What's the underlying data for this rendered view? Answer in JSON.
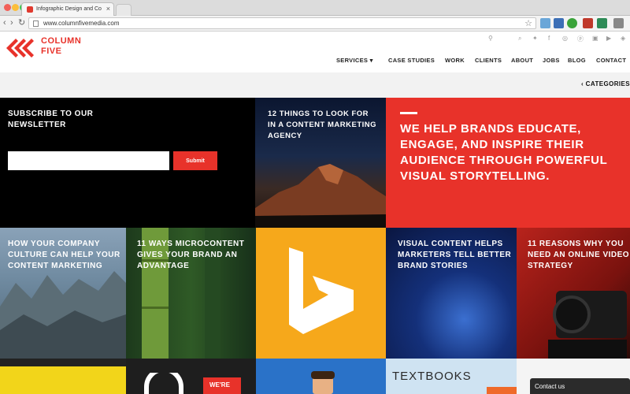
{
  "browser": {
    "tab_title": "Infographic Design and Co",
    "tab_close": "×",
    "url": "www.columnfivemedia.com",
    "back": "‹",
    "forward": "›",
    "reload": "↻",
    "star": "☆"
  },
  "site": {
    "logo_line1": "COLUMN",
    "logo_line2": "FIVE",
    "brand_color": "#e8322a",
    "nav": {
      "services": "SERVICES ▾",
      "case_studies": "CASE STUDIES",
      "work": "WORK",
      "clients": "CLIENTS",
      "about": "ABOUT",
      "jobs": "JOBS",
      "blog": "BLOG",
      "contact": "CONTACT"
    },
    "categories": "‹ CATEGORIES"
  },
  "newsletter": {
    "title": "SUBSCRIBE TO OUR NEWSLETTER",
    "email_value": "",
    "submit_label": "Submit"
  },
  "tiles": {
    "things_to_look": "12 THINGS TO LOOK FOR IN A CONTENT MARKETING AGENCY",
    "hero": "WE HELP BRANDS EDUCATE, ENGAGE, AND INSPIRE THEIR AUDIENCE THROUGH POWERFUL VISUAL STORYTELLING.",
    "company_culture": "HOW YOUR COMPANY CULTURE CAN HELP YOUR CONTENT MARKETING",
    "microcontent": "11 WAYS MICROCONTENT GIVES YOUR BRAND AN ADVANTAGE",
    "visual_content": "VISUAL CONTENT HELPS MARKETERS TELL BETTER BRAND STORIES",
    "video_strategy": "11 REASONS WHY YOU NEED AN ONLINE VIDEO STRATEGY",
    "textbooks": "TEXTBOOKS",
    "were": "WE'RE"
  },
  "contact_tab": "Contact us"
}
